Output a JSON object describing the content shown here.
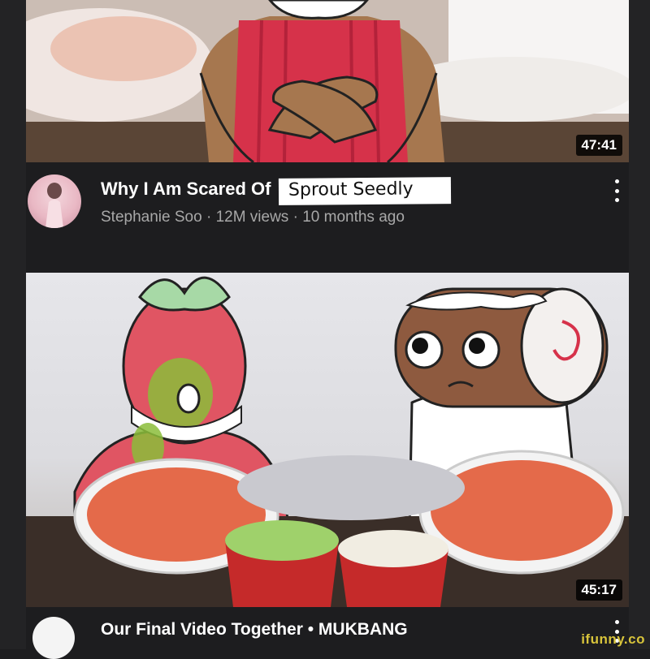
{
  "videos": [
    {
      "duration": "47:41",
      "title": "Why I Am Scared Of",
      "title_overwrite": "Sprout Seedly",
      "channel": "Stephanie Soo",
      "views": "12M views",
      "age": "10 months ago",
      "separator": "·"
    },
    {
      "duration": "45:17",
      "title": "Our Final Video Together • MUKBANG"
    }
  ],
  "watermark": "ifunny.co",
  "icons": {
    "menu": "more-vert-icon"
  },
  "colors": {
    "background": "#1d1d1f",
    "secondary_text": "#a8a8a8",
    "watermark": "#d8c43b"
  }
}
